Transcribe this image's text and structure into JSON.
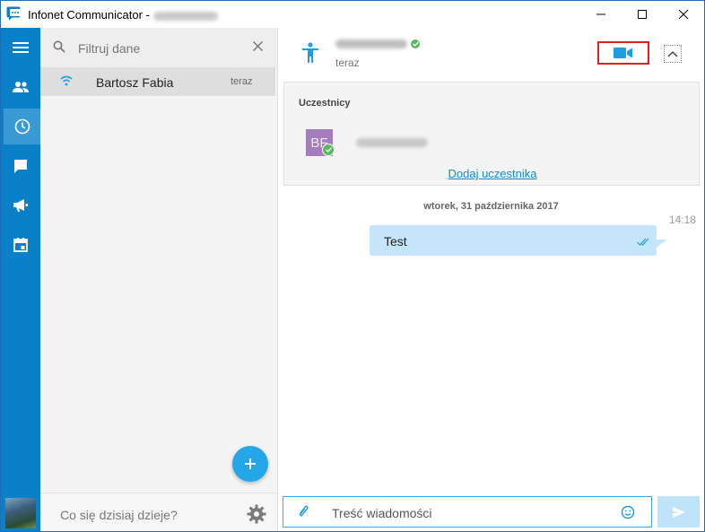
{
  "window": {
    "title": "Infonet Communicator -",
    "controls": {
      "minimize": "minimize-icon",
      "maximize": "maximize-icon",
      "close": "close-icon"
    }
  },
  "nav": {
    "items": [
      {
        "icon": "menu-icon"
      },
      {
        "icon": "contacts-icon"
      },
      {
        "icon": "recent-icon",
        "active": true
      },
      {
        "icon": "chat-icon"
      },
      {
        "icon": "megaphone-icon"
      },
      {
        "icon": "calendar-icon"
      }
    ]
  },
  "search": {
    "placeholder": "Filtruj dane"
  },
  "contacts": [
    {
      "name": "Bartosz Fabia",
      "time": "teraz"
    }
  ],
  "status": {
    "placeholder": "Co się dzisiaj dzieje?"
  },
  "chat": {
    "status_text": "teraz",
    "participants_title": "Uczestnicy",
    "participant_initials": "BF",
    "add_participant": "Dodaj uczestnika",
    "day_label": "wtorek, 31 października 2017",
    "messages": [
      {
        "time": "14:18",
        "text": "Test"
      }
    ],
    "composer_placeholder": "Treść wiadomości"
  },
  "colors": {
    "accent": "#0a80c9",
    "fab": "#24a6e8",
    "bubble": "#c5e5fb",
    "highlight_border": "#e02020",
    "online": "#5cb85c"
  }
}
